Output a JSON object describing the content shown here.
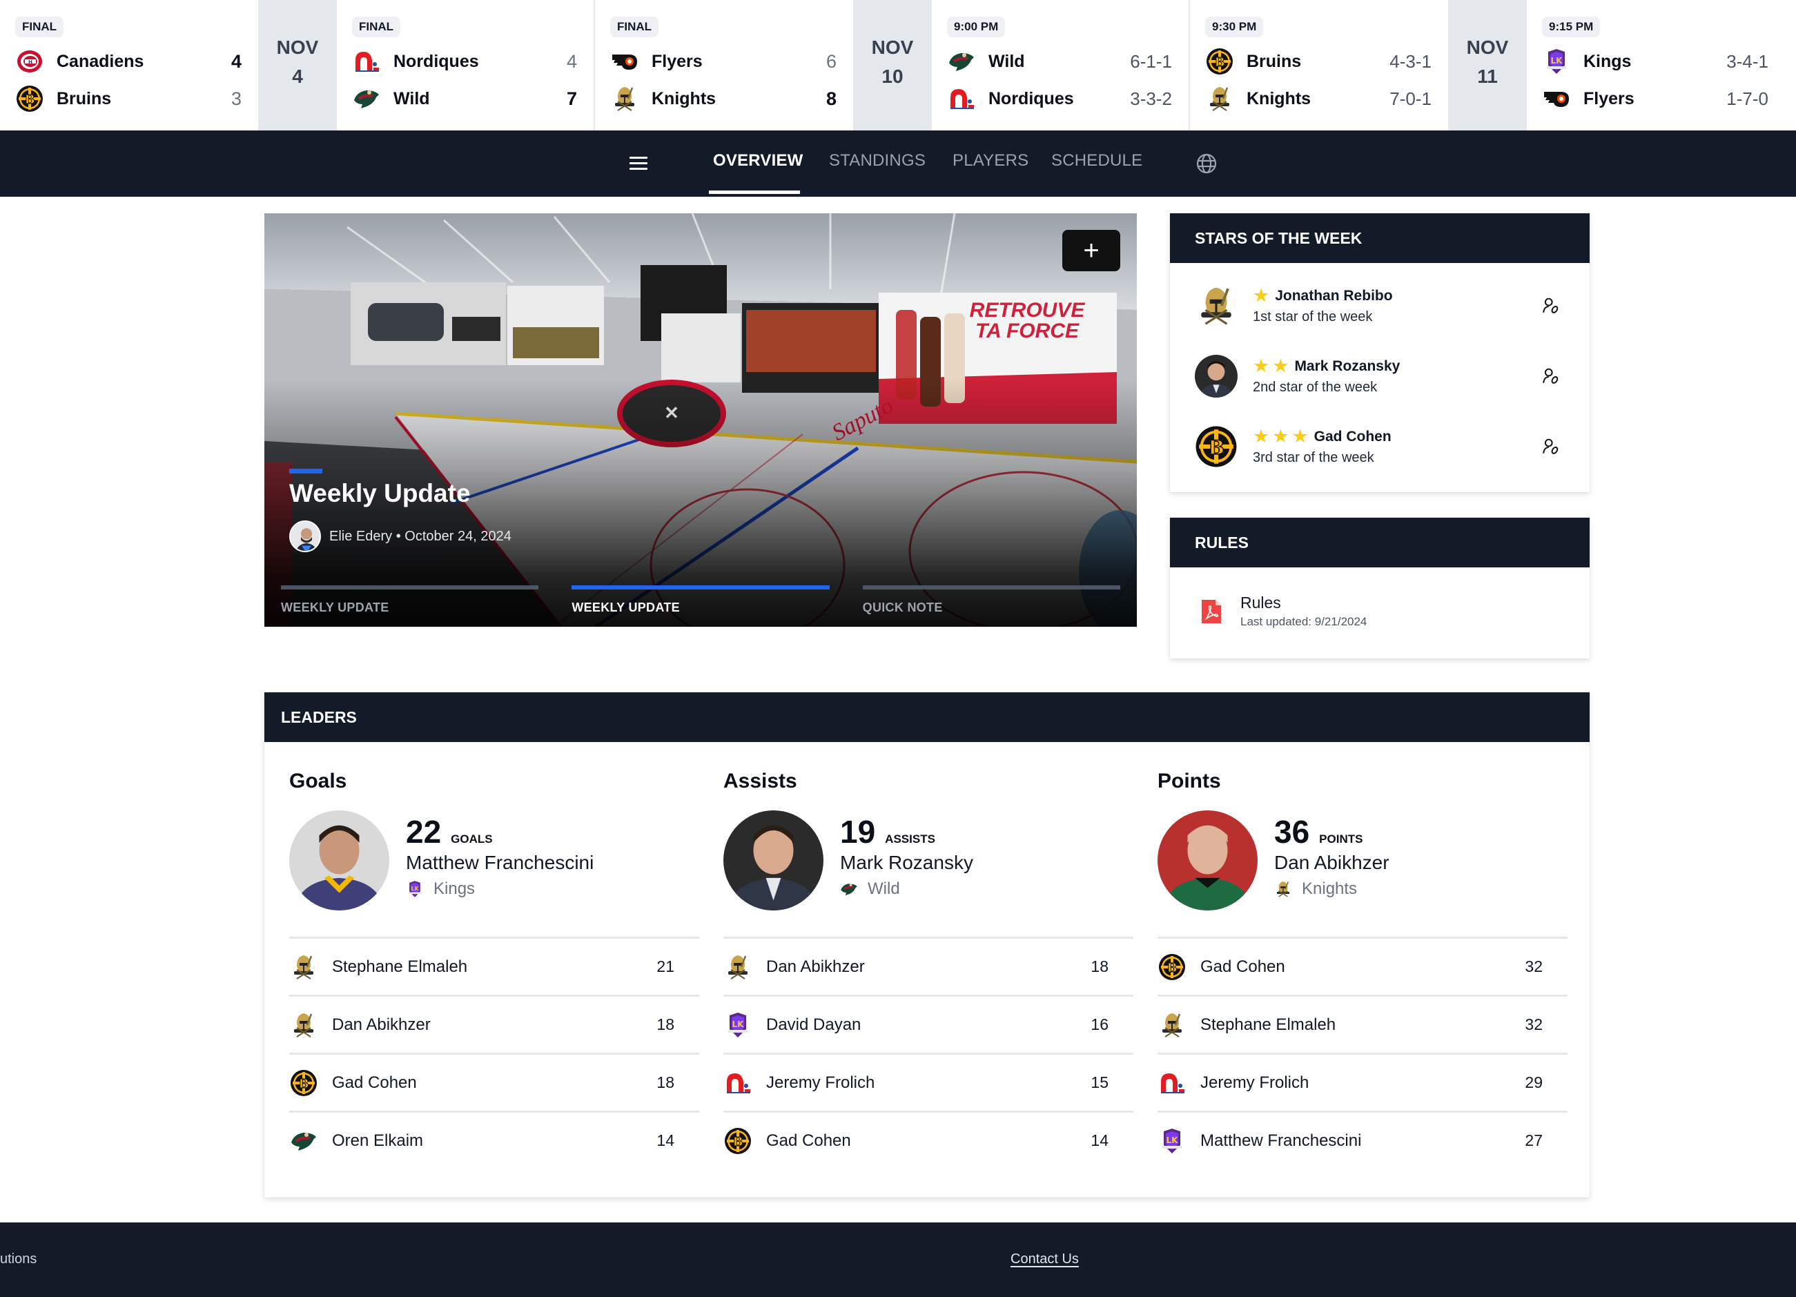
{
  "colors": {
    "navy": "#131a28",
    "accent_blue": "#2563eb",
    "star_yellow": "#facc15",
    "date_col_bg": "#e4e7ec",
    "pdf_red": "#ef4444"
  },
  "scoreboard": {
    "games": [
      {
        "status": "FINAL",
        "teams": [
          {
            "name": "Canadiens",
            "logo": "canadiens-logo",
            "value": "4",
            "winner": true
          },
          {
            "name": "Bruins",
            "logo": "bruins-logo",
            "value": "3",
            "winner": false
          }
        ]
      },
      {
        "status": "FINAL",
        "teams": [
          {
            "name": "Nordiques",
            "logo": "nordiques-logo",
            "value": "4",
            "winner": false
          },
          {
            "name": "Wild",
            "logo": "wild-logo",
            "value": "7",
            "winner": true
          }
        ]
      },
      {
        "status": "FINAL",
        "teams": [
          {
            "name": "Flyers",
            "logo": "flyers-logo",
            "value": "6",
            "winner": false
          },
          {
            "name": "Knights",
            "logo": "knights-logo",
            "value": "8",
            "winner": true
          }
        ]
      },
      {
        "status": "9:00 PM",
        "teams": [
          {
            "name": "Wild",
            "logo": "wild-logo",
            "value": "6-1-1"
          },
          {
            "name": "Nordiques",
            "logo": "nordiques-logo",
            "value": "3-3-2"
          }
        ]
      },
      {
        "status": "9:30 PM",
        "teams": [
          {
            "name": "Bruins",
            "logo": "bruins-logo",
            "value": "4-3-1"
          },
          {
            "name": "Knights",
            "logo": "knights-logo",
            "value": "7-0-1"
          }
        ]
      },
      {
        "status": "9:15 PM",
        "teams": [
          {
            "name": "Kings",
            "logo": "kings-logo",
            "value": "3-4-1"
          },
          {
            "name": "Flyers",
            "logo": "flyers-logo",
            "value": "1-7-0"
          }
        ]
      }
    ],
    "dates": [
      {
        "month": "NOV",
        "day": "4"
      },
      {
        "month": "NOV",
        "day": "10"
      },
      {
        "month": "NOV",
        "day": "11"
      }
    ]
  },
  "nav": {
    "menu_icon": "hamburger-icon",
    "tabs": [
      {
        "label": "OVERVIEW",
        "active": true
      },
      {
        "label": "STANDINGS",
        "active": false
      },
      {
        "label": "PLAYERS",
        "active": false
      },
      {
        "label": "SCHEDULE",
        "active": false
      }
    ],
    "language_icon": "globe-icon"
  },
  "hero": {
    "title": "Weekly Update",
    "author": "Elie Edery",
    "date": "October 24, 2024",
    "meta": "Elie Edery • October 24, 2024",
    "plus_icon": "plus-icon",
    "slides": [
      {
        "label": "WEEKLY UPDATE",
        "active": false
      },
      {
        "label": "WEEKLY UPDATE",
        "active": true
      },
      {
        "label": "QUICK NOTE",
        "active": false
      }
    ]
  },
  "stars_of_week": {
    "title": "STARS OF THE WEEK",
    "items": [
      {
        "name": "Jonathan Rebibo",
        "subtitle": "1st star of the week",
        "stars": 1,
        "logo": "knights-logo"
      },
      {
        "name": "Mark Rozansky",
        "subtitle": "2nd star of the week",
        "stars": 2,
        "logo": "player-photo"
      },
      {
        "name": "Gad Cohen",
        "subtitle": "3rd star of the week",
        "stars": 3,
        "logo": "bruins-logo"
      }
    ]
  },
  "rules": {
    "title": "RULES",
    "document": {
      "name": "Rules",
      "updated": "Last updated: 9/21/2024",
      "icon": "pdf-icon"
    }
  },
  "leaders": {
    "title": "LEADERS",
    "categories": [
      {
        "title": "Goals",
        "top": {
          "value": "22",
          "unit": "GOALS",
          "name": "Matthew Franchescini",
          "team": "Kings",
          "team_logo": "kings-logo"
        },
        "others": [
          {
            "name": "Stephane Elmaleh",
            "value": "21",
            "team_logo": "knights-logo"
          },
          {
            "name": "Dan Abikhzer",
            "value": "18",
            "team_logo": "knights-logo"
          },
          {
            "name": "Gad Cohen",
            "value": "18",
            "team_logo": "bruins-logo"
          },
          {
            "name": "Oren Elkaim",
            "value": "14",
            "team_logo": "wild-logo"
          }
        ]
      },
      {
        "title": "Assists",
        "top": {
          "value": "19",
          "unit": "ASSISTS",
          "name": "Mark Rozansky",
          "team": "Wild",
          "team_logo": "wild-logo"
        },
        "others": [
          {
            "name": "Dan Abikhzer",
            "value": "18",
            "team_logo": "knights-logo"
          },
          {
            "name": "David Dayan",
            "value": "16",
            "team_logo": "kings-logo"
          },
          {
            "name": "Jeremy Frolich",
            "value": "15",
            "team_logo": "nordiques-logo"
          },
          {
            "name": "Gad Cohen",
            "value": "14",
            "team_logo": "bruins-logo"
          }
        ]
      },
      {
        "title": "Points",
        "top": {
          "value": "36",
          "unit": "POINTS",
          "name": "Dan Abikhzer",
          "team": "Knights",
          "team_logo": "knights-logo"
        },
        "others": [
          {
            "name": "Gad Cohen",
            "value": "32",
            "team_logo": "bruins-logo"
          },
          {
            "name": "Stephane Elmaleh",
            "value": "32",
            "team_logo": "knights-logo"
          },
          {
            "name": "Jeremy Frolich",
            "value": "29",
            "team_logo": "nordiques-logo"
          },
          {
            "name": "Matthew Franchescini",
            "value": "27",
            "team_logo": "kings-logo"
          }
        ]
      }
    ]
  },
  "footer": {
    "left_text": "utions",
    "contact_link": "Contact Us"
  }
}
